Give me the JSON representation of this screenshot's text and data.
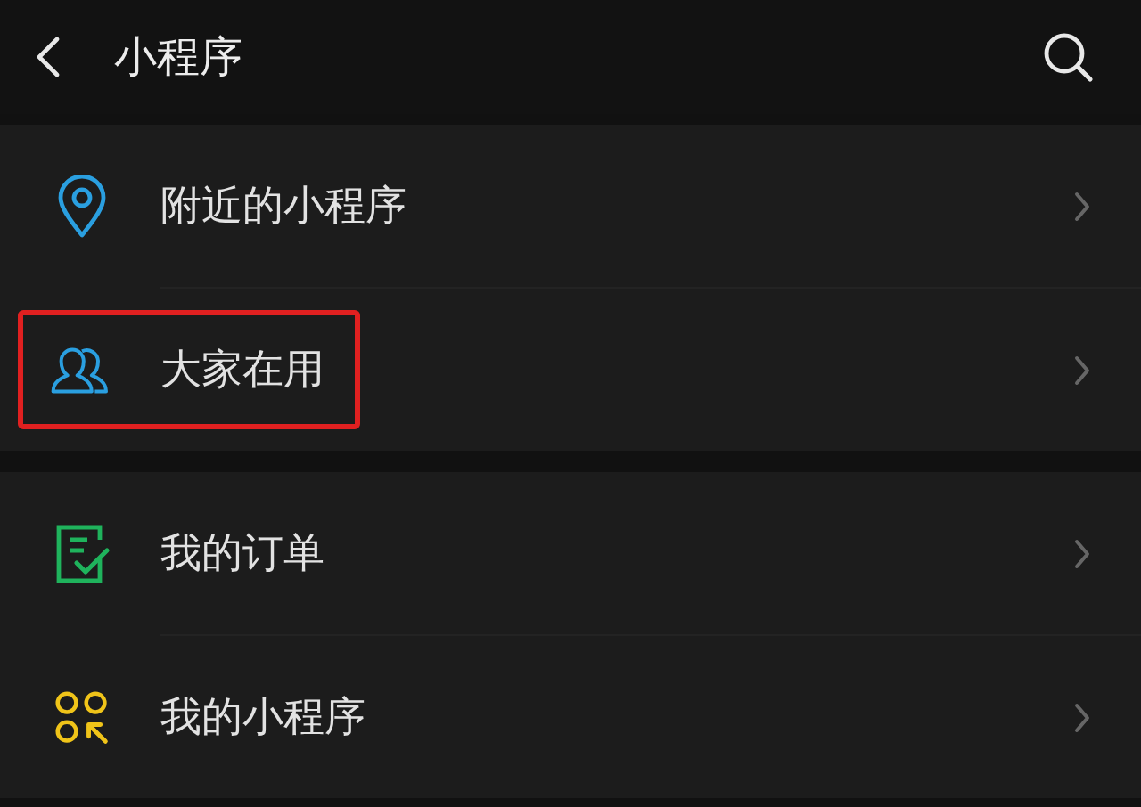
{
  "header": {
    "title": "小程序"
  },
  "groups": [
    {
      "items": [
        {
          "kind": "pin",
          "label": "附近的小程序",
          "highlighted": false
        },
        {
          "kind": "people",
          "label": "大家在用",
          "highlighted": true
        }
      ]
    },
    {
      "items": [
        {
          "kind": "order",
          "label": "我的订单",
          "highlighted": false
        },
        {
          "kind": "apps",
          "label": "我的小程序",
          "highlighted": false
        }
      ]
    }
  ]
}
